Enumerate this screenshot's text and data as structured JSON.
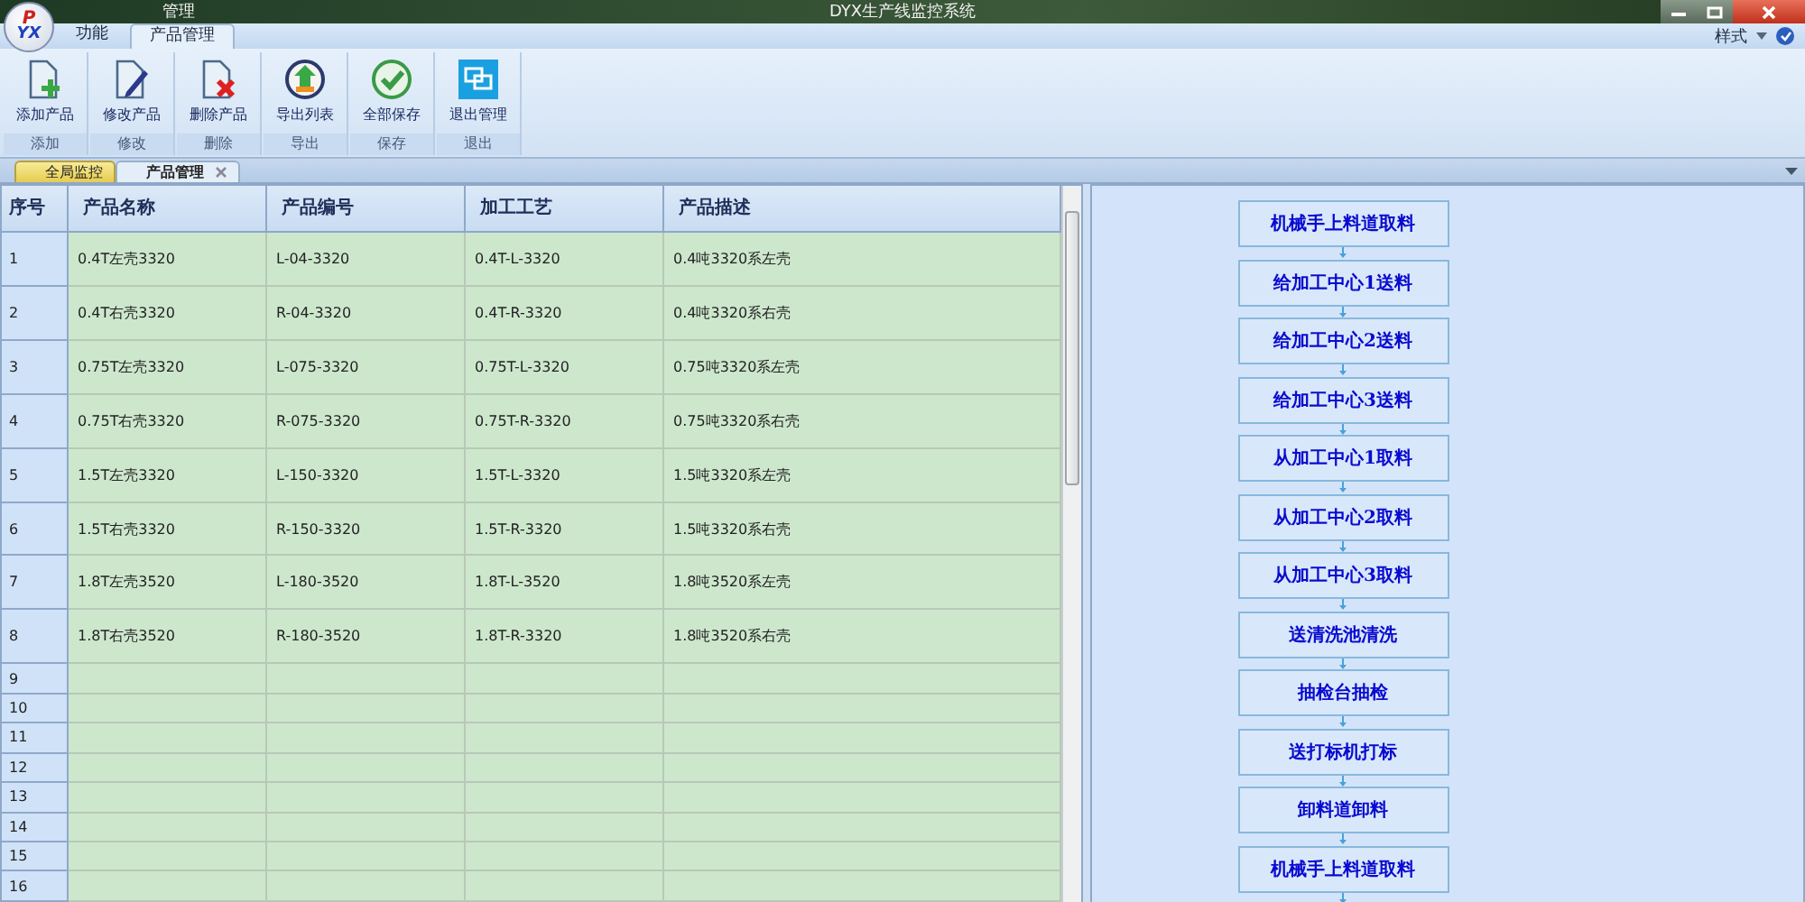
{
  "window": {
    "logo": {
      "top": "P",
      "bottom": "YX"
    },
    "caption": "管理",
    "title": "DYX生产线监控系统"
  },
  "ribbon_tabs": [
    {
      "label": "功能",
      "selected": false
    },
    {
      "label": "产品管理",
      "selected": true
    }
  ],
  "style_menu": "样式",
  "ribbon_groups": [
    {
      "label": "添加",
      "buttons": [
        {
          "kind": "add",
          "label": "添加产品"
        }
      ]
    },
    {
      "label": "修改",
      "buttons": [
        {
          "kind": "edit",
          "label": "修改产品"
        }
      ]
    },
    {
      "label": "删除",
      "buttons": [
        {
          "kind": "delete",
          "label": "删除产品"
        }
      ]
    },
    {
      "label": "导出",
      "buttons": [
        {
          "kind": "export",
          "label": "导出列表"
        }
      ]
    },
    {
      "label": "保存",
      "buttons": [
        {
          "kind": "save",
          "label": "全部保存"
        }
      ]
    },
    {
      "label": "退出",
      "buttons": [
        {
          "kind": "exit",
          "label": "退出管理"
        }
      ]
    }
  ],
  "document_tabs": [
    {
      "label": "全局监控",
      "selected": false,
      "closable": false
    },
    {
      "label": "产品管理",
      "selected": true,
      "closable": true
    }
  ],
  "table": {
    "columns": [
      "序号",
      "产品名称",
      "产品编号",
      "加工工艺",
      "产品描述"
    ],
    "rows": [
      {
        "no": "1",
        "cells": [
          "0.4T左壳3320",
          "L-04-3320",
          "0.4T-L-3320",
          "0.4吨3320系左壳"
        ]
      },
      {
        "no": "2",
        "cells": [
          "0.4T右壳3320",
          "R-04-3320",
          "0.4T-R-3320",
          "0.4吨3320系右壳"
        ]
      },
      {
        "no": "3",
        "cells": [
          "0.75T左壳3320",
          "L-075-3320",
          "0.75T-L-3320",
          "0.75吨3320系左壳"
        ]
      },
      {
        "no": "4",
        "cells": [
          "0.75T右壳3320",
          "R-075-3320",
          "0.75T-R-3320",
          "0.75吨3320系右壳"
        ]
      },
      {
        "no": "5",
        "cells": [
          "1.5T左壳3320",
          "L-150-3320",
          "1.5T-L-3320",
          "1.5吨3320系左壳"
        ]
      },
      {
        "no": "6",
        "cells": [
          "1.5T右壳3320",
          "R-150-3320",
          "1.5T-R-3320",
          "1.5吨3320系右壳"
        ]
      },
      {
        "no": "7",
        "cells": [
          "1.8T左壳3520",
          "L-180-3520",
          "1.8T-L-3520",
          "1.8吨3520系左壳"
        ]
      },
      {
        "no": "8",
        "cells": [
          "1.8T右壳3520",
          "R-180-3520",
          "1.8T-R-3320",
          "1.8吨3520系右壳"
        ]
      },
      {
        "no": "9"
      },
      {
        "no": "10"
      },
      {
        "no": "11"
      },
      {
        "no": "12"
      },
      {
        "no": "13"
      },
      {
        "no": "14"
      },
      {
        "no": "15"
      },
      {
        "no": "16"
      }
    ]
  },
  "flow_steps": [
    "机械手上料道取料",
    "给加工中心1送料",
    "给加工中心2送料",
    "给加工中心3送料",
    "从加工中心1取料",
    "从加工中心2取料",
    "从加工中心3取料",
    "送清洗池清洗",
    "抽检台抽检",
    "送打标机打标",
    "卸料道卸料",
    "机械手上料道取料"
  ]
}
